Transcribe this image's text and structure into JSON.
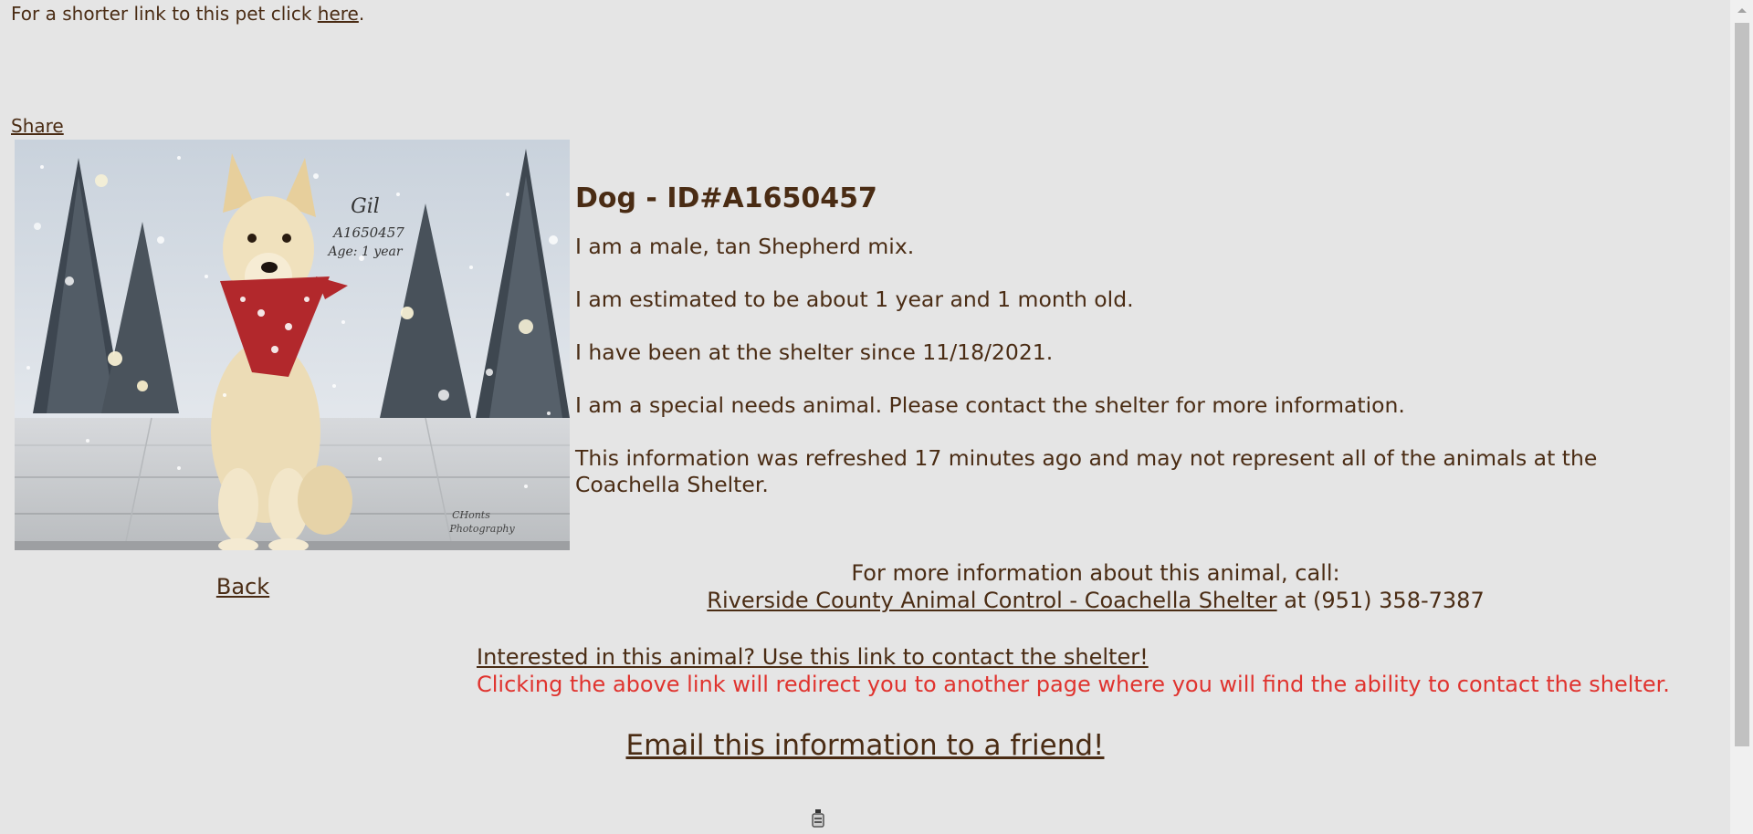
{
  "top": {
    "shorter_link_text": "For a shorter link to this pet click ",
    "here_link": "here",
    "period": "."
  },
  "share_link": "Share",
  "photo": {
    "name_text": "Gil",
    "id_text": "A1650457",
    "age_text": "Age: 1 year",
    "credit_line1": "CHonts",
    "credit_line2": "Photography"
  },
  "back_link": "Back",
  "animal": {
    "title": "Dog - ID#A1650457",
    "desc": "I am a male, tan Shepherd mix.",
    "age": "I am estimated to be about 1 year and 1 month old.",
    "since": "I have been at the shelter since 11/18/2021.",
    "special_needs": "I am a special needs animal. Please contact the shelter for more information.",
    "refresh": "This information was refreshed 17 minutes ago and may not represent all of the animals at the Coachella Shelter."
  },
  "contact": {
    "intro": "For more information about this animal, call:",
    "shelter_link": "Riverside County Animal Control - Coachella Shelter",
    "phone": " at (951) 358-7387"
  },
  "interest": {
    "link": "Interested in this animal? Use this link to contact the shelter!",
    "warning": "Clicking the above link will redirect you to another page where you will find the ability to contact the shelter."
  },
  "email_link": "Email this information to a friend!",
  "colors": {
    "background": "#e5e5e5",
    "text": "#4a2c14",
    "warning": "#e0332e"
  }
}
